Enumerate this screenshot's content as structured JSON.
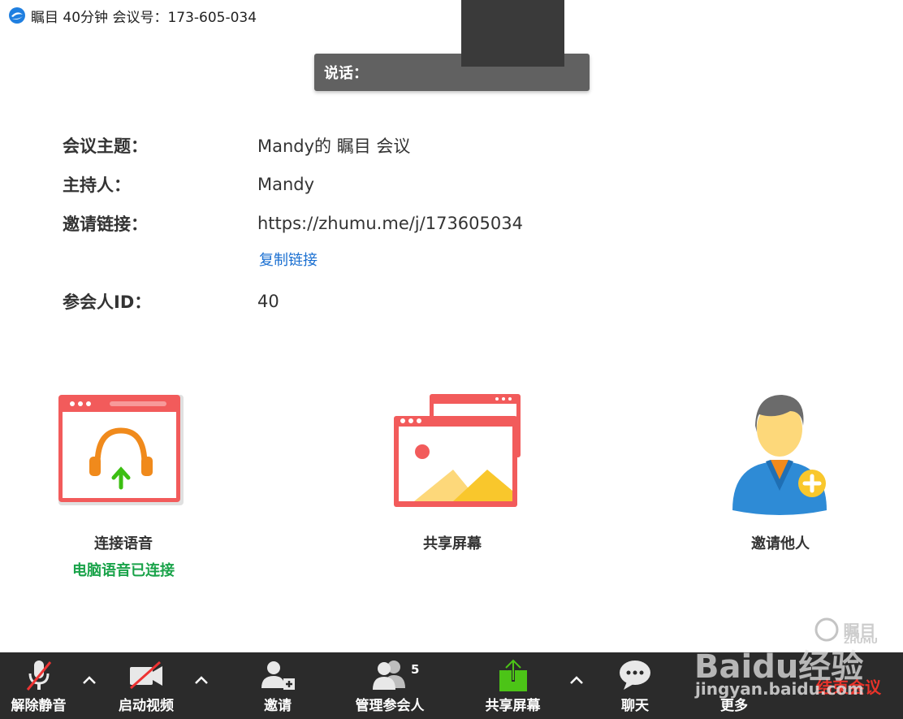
{
  "window": {
    "title": "瞩目 40分钟 会议号：173-605-034"
  },
  "speaking": {
    "label": "说话："
  },
  "info": {
    "topic_label": "会议主题：",
    "topic_value": "Mandy的 瞩目 会议",
    "host_label": "主持人：",
    "host_value": "Mandy",
    "link_label": "邀请链接：",
    "link_value": "https://zhumu.me/j/173605034",
    "copy_link": "复制链接",
    "participant_label": "参会人ID：",
    "participant_value": "40"
  },
  "actions": {
    "audio_label": "连接语音",
    "audio_status": "电脑语音已连接",
    "share_label": "共享屏幕",
    "invite_label": "邀请他人"
  },
  "toolbar": {
    "unmute": "解除静音",
    "start_video": "启动视频",
    "invite": "邀请",
    "manage": "管理参会人",
    "participant_count": "5",
    "share": "共享屏幕",
    "chat": "聊天",
    "more": "更多",
    "end": "结束会议"
  },
  "watermark": {
    "brand": "Baidu经验",
    "url": "jingyan.baidu.com",
    "logo_text": "瞩目",
    "logo_sub": "ZHUMU"
  },
  "colors": {
    "accent_red": "#f25b5b",
    "audio_green": "#1aa34a",
    "link_blue": "#1a6fd1",
    "end_red": "#e8332a",
    "share_green": "#4cc417"
  }
}
